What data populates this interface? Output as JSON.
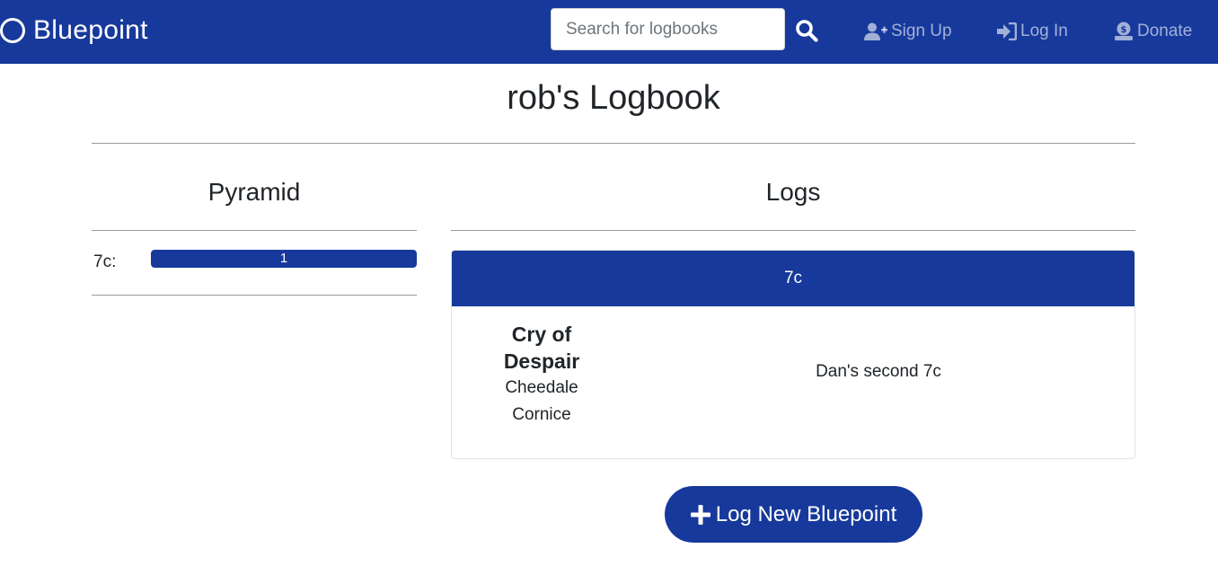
{
  "navbar": {
    "brand": "Bluepoint",
    "search_placeholder": "Search for logbooks",
    "links": {
      "signup": "Sign Up",
      "login": "Log In",
      "donate": "Donate"
    },
    "colors": {
      "background": "#17399b",
      "link": "rgba(255,255,255,0.6)"
    }
  },
  "page": {
    "title": "rob's Logbook"
  },
  "pyramid": {
    "title": "Pyramid",
    "rows": [
      {
        "grade": "7c:",
        "count": "1",
        "fill_fraction": 1.0
      }
    ]
  },
  "logs": {
    "title": "Logs",
    "groups": [
      {
        "grade": "7c",
        "entries": [
          {
            "climb_name": "Cry of Despair",
            "area": "Cheedale Cornice",
            "comment": "Dan's second 7c"
          }
        ]
      }
    ],
    "add_button": "Log New Bluepoint"
  }
}
